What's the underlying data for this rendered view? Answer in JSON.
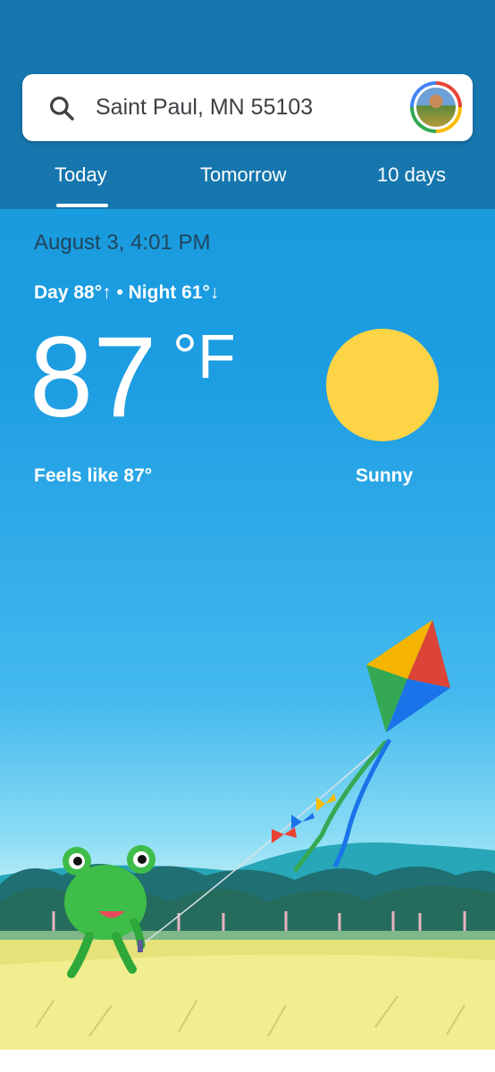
{
  "search": {
    "location": "Saint Paul, MN 55103",
    "icon": "search-icon"
  },
  "tabs": [
    {
      "label": "Today",
      "selected": true
    },
    {
      "label": "Tomorrow",
      "selected": false
    },
    {
      "label": "10 days",
      "selected": false
    }
  ],
  "weather": {
    "datetime": "August 3, 4:01 PM",
    "day_night": "Day 88°↑ • Night 61°↓",
    "temperature": "87",
    "unit": "°F",
    "feels_like": "Feels like 87°",
    "condition": "Sunny",
    "condition_icon": "sun-icon"
  },
  "colors": {
    "header": "#1676ad",
    "sky": "#1d9de2",
    "sun": "#fdd445"
  }
}
